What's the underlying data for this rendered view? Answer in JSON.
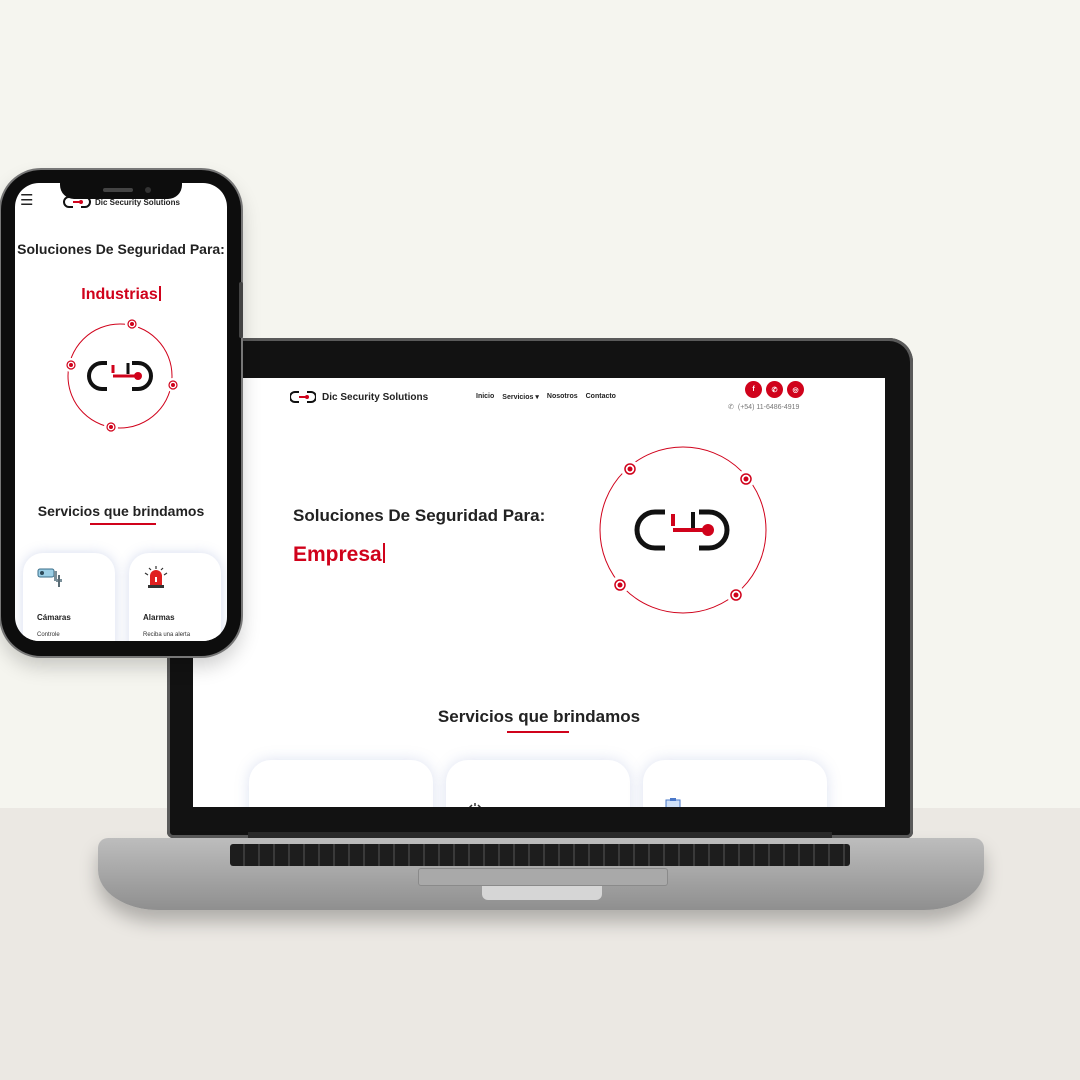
{
  "brand": {
    "name": "Dic Security Solutions",
    "accent": "#d0021b"
  },
  "desktop": {
    "nav": [
      {
        "label": "Inicio"
      },
      {
        "label": "Servicios"
      },
      {
        "label": "Nosotros"
      },
      {
        "label": "Contacto"
      }
    ],
    "nav_dropdown_icon": "caret-down-icon",
    "social": [
      {
        "icon": "facebook-icon",
        "glyph": "f"
      },
      {
        "icon": "whatsapp-icon",
        "glyph": "✆"
      },
      {
        "icon": "instagram-icon",
        "glyph": "◎"
      }
    ],
    "phone": "(+54) 11-6486-4919",
    "hero": {
      "title": "Soluciones De Seguridad Para:",
      "typed_word": "Empresa"
    },
    "services_title": "Servicios que brindamos"
  },
  "mobile": {
    "menu_icon": "hamburger-icon",
    "hero": {
      "title": "Soluciones De Seguridad Para:",
      "typed_word": "Industrias"
    },
    "services_title": "Servicios que brindamos",
    "cards": [
      {
        "title": "Cámaras",
        "text": "Controle",
        "icon": "camera-icon"
      },
      {
        "title": "Alarmas",
        "text": "Reciba una alerta",
        "icon": "siren-icon"
      }
    ]
  }
}
